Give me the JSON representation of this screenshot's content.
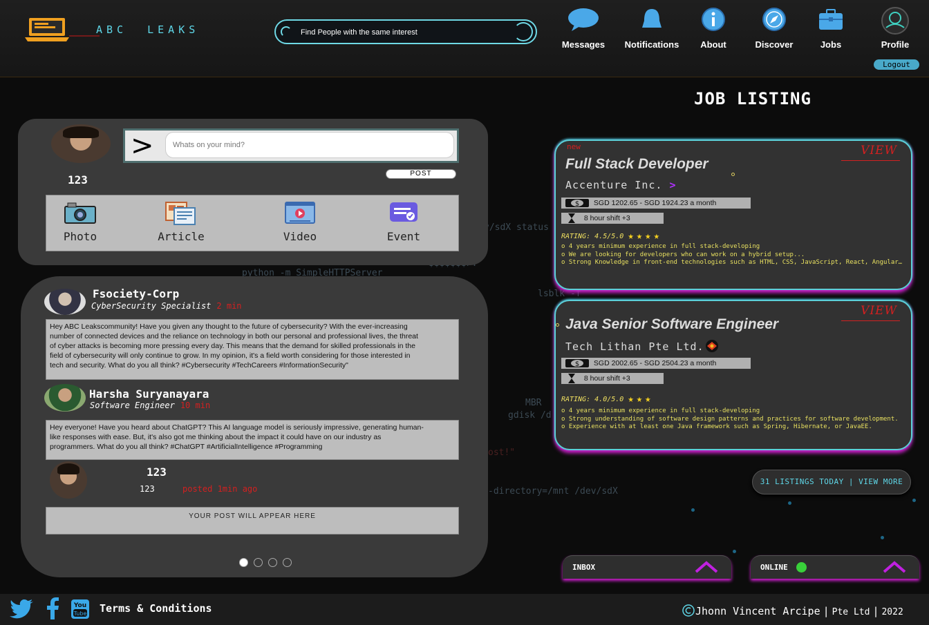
{
  "brand": {
    "abc": "ABC",
    "leaks": "LEAKS"
  },
  "search": {
    "placeholder": "Find People with the same interest"
  },
  "nav": {
    "messages": "Messages",
    "notifications": "Notifications",
    "about": "About",
    "discover": "Discover",
    "jobs": "Jobs",
    "profile": "Profile",
    "logout": "Logout"
  },
  "composer": {
    "count": "123",
    "placeholder": "Whats on your mind?",
    "post_label": "POST",
    "media": {
      "photo": "Photo",
      "article": "Article",
      "video": "Video",
      "event": "Event"
    }
  },
  "feed": {
    "posts": [
      {
        "name": "Fsociety-Corp",
        "role": "CyberSecurity Specialist",
        "time": "2 min",
        "body": "Hey ABC Leakscommunity! Have you given any thought to the future of cybersecurity? With the ever-increasing number of connected devices and the reliance on technology in both our personal and professional lives, the threat of cyber attacks is becoming more pressing every day. This means that the demand for skilled professionals in the field of cybersecurity will only continue to grow. In my opinion, it's a field worth considering for those interested in tech and security. What do you all think? #Cybersecurity #TechCareers #InformationSecurity\""
      },
      {
        "name": "Harsha Suryanayara",
        "role": "Software Engineer",
        "time": "10 min",
        "body": "Hey everyone! Have you heard about ChatGPT? This AI language model is seriously impressive, generating human-like responses with ease. But, it's also got me thinking about the impact it could have on our industry as programmers. What do you all think? #ChatGPT #ArtificialIntelligence #Programming"
      }
    ],
    "yours": {
      "count_big": "123",
      "count_small": "123",
      "time": "posted 1min ago",
      "body": "YOUR POST WILL APPEAR HERE"
    }
  },
  "jobs": {
    "title": "JOB LISTING",
    "items": [
      {
        "badge": "new",
        "view": "VIEW",
        "title": "Full Stack Developer",
        "company": "Accenture Inc.",
        "salary": "SGD 1202.65 - SGD 1924.23 a month",
        "shift": "8 hour shift +3",
        "rating_label": "RATING: 4.5/5.0",
        "stars": "★★★★",
        "reqs": [
          "4 years minimum experience in full stack-developing",
          "We are looking for developers who can work on a hybrid setup...",
          "Strong Knowledge in front-end technologies such as HTML, CSS, JavaScript, React, Angular,..."
        ]
      },
      {
        "badge": "",
        "view": "VIEW",
        "title": "Java Senior Software Engineer",
        "company": "Tech Lithan Pte Ltd.",
        "salary": "SGD 2002.65 - SGD 2504.23 a month",
        "shift": "8 hour shift +3",
        "rating_label": "RATING: 4.0/5.0",
        "stars": "★★★",
        "reqs": [
          "4 years minimum experience in full stack-developing",
          "Strong understanding of software design patterns and practices for software development.",
          "Experience with at least one Java framework such as Spring, Hibernate, or JavaEE."
        ]
      }
    ],
    "listings": "31 LISTINGS TODAY | VIEW MORE"
  },
  "chat": {
    "inbox": "INBOX",
    "online": "ONLINE"
  },
  "footer": {
    "terms": "Terms & Conditions",
    "author": "Jhonn Vincent Arcipe",
    "company": "Pte Ltd",
    "year": "2022"
  },
  "background_code": [
    "v/sdX status",
    "python -m SimpleHTTPServer",
    "$$$$$$$P.",
    "lsblk -f",
    "MBR",
    "gdisk /d",
    "-directory=/mnt /dev/sdX",
    "ost!\""
  ],
  "colors": {
    "accent": "#5fd7e8",
    "alert": "#d42020",
    "glow": "#d020d0",
    "rating": "#f0e060"
  }
}
